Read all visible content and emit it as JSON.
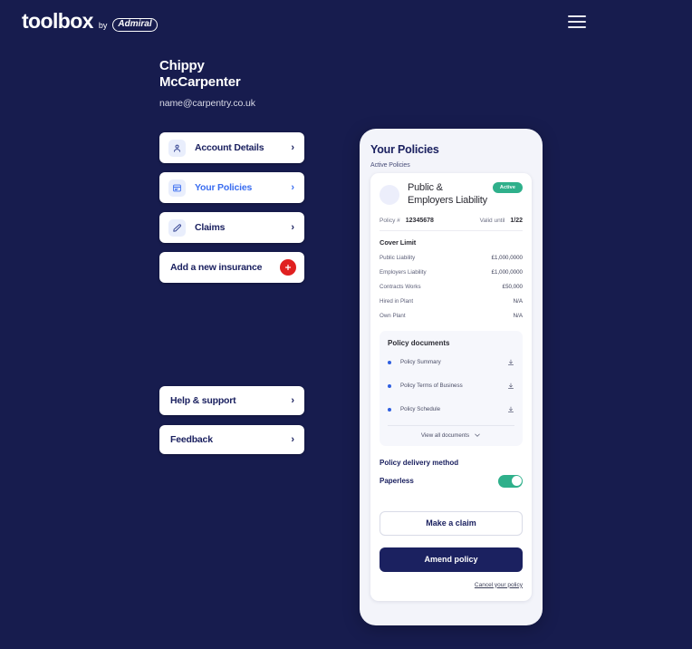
{
  "brand": {
    "word": "toolbox",
    "by": "by",
    "partner": "Admiral",
    "menu_icon": "hamburger-icon",
    "bg_color": "#171c4e",
    "accent_blue": "#3a6df0",
    "accent_navy": "#1b2160",
    "accent_green": "#2fb08b",
    "accent_red": "#e02020"
  },
  "user": {
    "name": "Chippy McCarpenter",
    "name_line1": "Chippy",
    "name_line2": "McCarpenter",
    "email": "name@carpentry.co.uk"
  },
  "sidebar": {
    "items": [
      {
        "label": "Account Details",
        "icon": "user-icon",
        "active": false,
        "chevron": "›"
      },
      {
        "label": "Your Policies",
        "icon": "policy-document-icon",
        "active": true,
        "chevron": "›"
      },
      {
        "label": "Claims",
        "icon": "pencil-icon",
        "active": false,
        "chevron": "›"
      }
    ],
    "add_insurance": {
      "label": "Add a new insurance",
      "icon": "plus-icon"
    },
    "bottom_items": [
      {
        "label": "Help & support",
        "chevron": "›"
      },
      {
        "label": "Feedback",
        "chevron": "›"
      }
    ]
  },
  "panel": {
    "title": "Your Policies",
    "subtitle": "Active Policies",
    "policy": {
      "name_line1": "Public &",
      "name_line2": "Employers Liability",
      "status_badge": "Active",
      "avatar": "policy-avatar",
      "meta": {
        "policy_number_label": "Policy #",
        "policy_number": "12345678",
        "valid_until_label": "Valid until",
        "valid_until": "1/22"
      },
      "cover_limit_heading": "Cover Limit",
      "cover_limits": [
        {
          "label": "Public Liability",
          "value": "£1,000,0000"
        },
        {
          "label": "Employers Liability",
          "value": "£1,000,0000"
        },
        {
          "label": "Contracts Works",
          "value": "£50,000"
        },
        {
          "label": "Hired in Plant",
          "value": "N/A"
        },
        {
          "label": "Own Plant",
          "value": "N/A"
        }
      ],
      "documents": {
        "heading": "Policy documents",
        "items": [
          {
            "name": "Policy Summary",
            "icon": "download-icon"
          },
          {
            "name": "Policy Terms of Business",
            "icon": "download-icon"
          },
          {
            "name": "Policy Schedule",
            "icon": "download-icon"
          }
        ],
        "view_all_label": "View all documents",
        "view_all_icon": "chevron-down-icon"
      },
      "delivery": {
        "heading": "Policy delivery method",
        "option_label": "Paperless",
        "enabled": true
      },
      "actions": {
        "make_claim": "Make a claim",
        "amend_policy": "Amend policy",
        "cancel_policy": "Cancel your policy"
      }
    }
  }
}
